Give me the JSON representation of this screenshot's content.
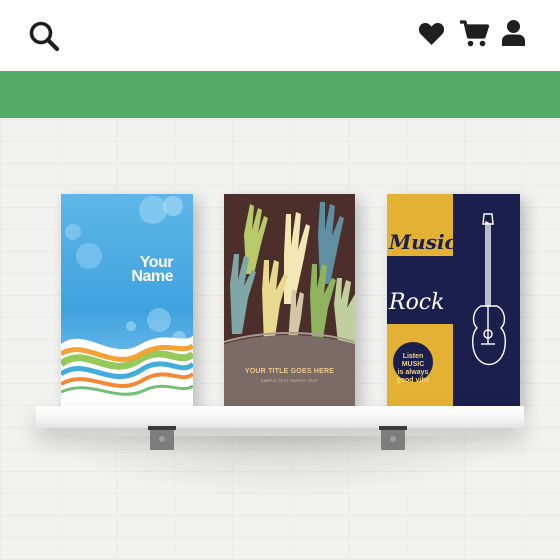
{
  "header": {
    "icons": {
      "search": "search-icon",
      "wishlist": "heart-icon",
      "cart": "shopping-cart-icon",
      "account": "user-icon"
    },
    "icon_color": "#1f1f1f"
  },
  "banner": {
    "color": "#54ab67"
  },
  "shelf": {
    "books": [
      {
        "cover_text": [
          "Your",
          "Name"
        ]
      },
      {
        "title": "YOUR TITLE GOES HERE",
        "subtitle": "SIMPLE TEXT SIMPLE TEXT"
      },
      {
        "script_1": "Music",
        "script_2": "Rock",
        "badge": [
          "Listen",
          "MUSIC",
          "is always",
          "good vibe"
        ]
      }
    ]
  }
}
